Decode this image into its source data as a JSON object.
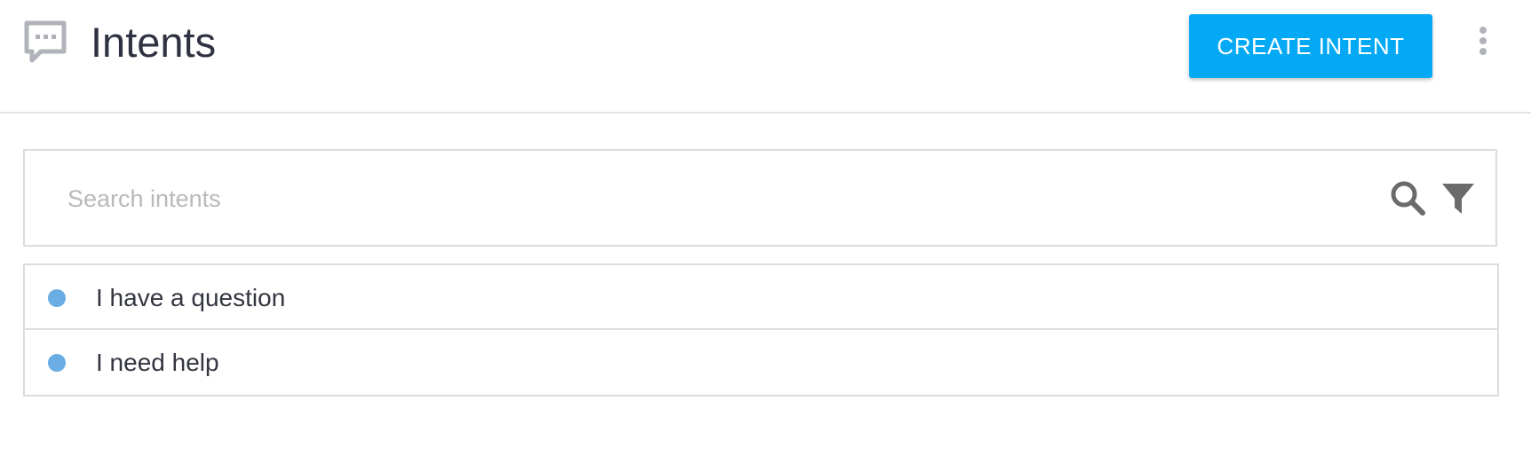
{
  "header": {
    "icon": "chat-bubble-icon",
    "title": "Intents",
    "create_button_label": "CREATE INTENT",
    "menu_icon": "more-vertical-icon"
  },
  "search": {
    "placeholder": "Search intents",
    "value": "",
    "search_icon": "search-icon",
    "filter_icon": "filter-icon"
  },
  "intents": [
    {
      "label": "I have a question",
      "dot_color": "#6aade4"
    },
    {
      "label": "I need help",
      "dot_color": "#6aade4"
    }
  ],
  "colors": {
    "accent": "#03a9f4",
    "icon_gray": "#b0b3ba",
    "search_icon_gray": "#6b6b6b",
    "intent_dot": "#6aade4"
  }
}
